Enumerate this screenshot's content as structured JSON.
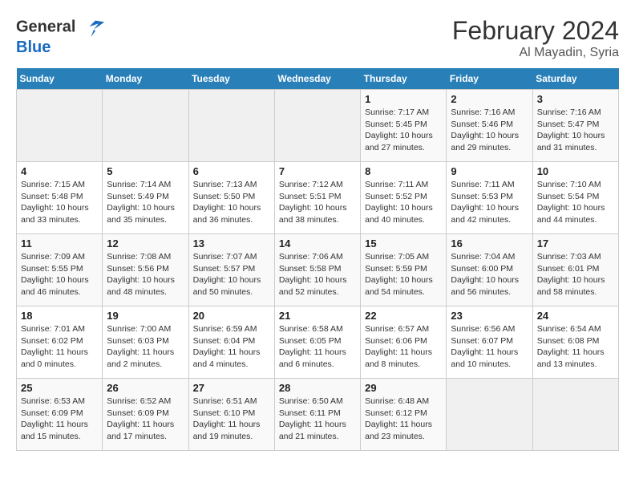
{
  "app": {
    "name": "GeneralBlue",
    "logo_color": "#1a6abf"
  },
  "header": {
    "title": "February 2024",
    "location": "Al Mayadin, Syria"
  },
  "weekdays": [
    "Sunday",
    "Monday",
    "Tuesday",
    "Wednesday",
    "Thursday",
    "Friday",
    "Saturday"
  ],
  "weeks": [
    [
      {
        "day": "",
        "info": ""
      },
      {
        "day": "",
        "info": ""
      },
      {
        "day": "",
        "info": ""
      },
      {
        "day": "",
        "info": ""
      },
      {
        "day": "1",
        "info": "Sunrise: 7:17 AM\nSunset: 5:45 PM\nDaylight: 10 hours and 27 minutes."
      },
      {
        "day": "2",
        "info": "Sunrise: 7:16 AM\nSunset: 5:46 PM\nDaylight: 10 hours and 29 minutes."
      },
      {
        "day": "3",
        "info": "Sunrise: 7:16 AM\nSunset: 5:47 PM\nDaylight: 10 hours and 31 minutes."
      }
    ],
    [
      {
        "day": "4",
        "info": "Sunrise: 7:15 AM\nSunset: 5:48 PM\nDaylight: 10 hours and 33 minutes."
      },
      {
        "day": "5",
        "info": "Sunrise: 7:14 AM\nSunset: 5:49 PM\nDaylight: 10 hours and 35 minutes."
      },
      {
        "day": "6",
        "info": "Sunrise: 7:13 AM\nSunset: 5:50 PM\nDaylight: 10 hours and 36 minutes."
      },
      {
        "day": "7",
        "info": "Sunrise: 7:12 AM\nSunset: 5:51 PM\nDaylight: 10 hours and 38 minutes."
      },
      {
        "day": "8",
        "info": "Sunrise: 7:11 AM\nSunset: 5:52 PM\nDaylight: 10 hours and 40 minutes."
      },
      {
        "day": "9",
        "info": "Sunrise: 7:11 AM\nSunset: 5:53 PM\nDaylight: 10 hours and 42 minutes."
      },
      {
        "day": "10",
        "info": "Sunrise: 7:10 AM\nSunset: 5:54 PM\nDaylight: 10 hours and 44 minutes."
      }
    ],
    [
      {
        "day": "11",
        "info": "Sunrise: 7:09 AM\nSunset: 5:55 PM\nDaylight: 10 hours and 46 minutes."
      },
      {
        "day": "12",
        "info": "Sunrise: 7:08 AM\nSunset: 5:56 PM\nDaylight: 10 hours and 48 minutes."
      },
      {
        "day": "13",
        "info": "Sunrise: 7:07 AM\nSunset: 5:57 PM\nDaylight: 10 hours and 50 minutes."
      },
      {
        "day": "14",
        "info": "Sunrise: 7:06 AM\nSunset: 5:58 PM\nDaylight: 10 hours and 52 minutes."
      },
      {
        "day": "15",
        "info": "Sunrise: 7:05 AM\nSunset: 5:59 PM\nDaylight: 10 hours and 54 minutes."
      },
      {
        "day": "16",
        "info": "Sunrise: 7:04 AM\nSunset: 6:00 PM\nDaylight: 10 hours and 56 minutes."
      },
      {
        "day": "17",
        "info": "Sunrise: 7:03 AM\nSunset: 6:01 PM\nDaylight: 10 hours and 58 minutes."
      }
    ],
    [
      {
        "day": "18",
        "info": "Sunrise: 7:01 AM\nSunset: 6:02 PM\nDaylight: 11 hours and 0 minutes."
      },
      {
        "day": "19",
        "info": "Sunrise: 7:00 AM\nSunset: 6:03 PM\nDaylight: 11 hours and 2 minutes."
      },
      {
        "day": "20",
        "info": "Sunrise: 6:59 AM\nSunset: 6:04 PM\nDaylight: 11 hours and 4 minutes."
      },
      {
        "day": "21",
        "info": "Sunrise: 6:58 AM\nSunset: 6:05 PM\nDaylight: 11 hours and 6 minutes."
      },
      {
        "day": "22",
        "info": "Sunrise: 6:57 AM\nSunset: 6:06 PM\nDaylight: 11 hours and 8 minutes."
      },
      {
        "day": "23",
        "info": "Sunrise: 6:56 AM\nSunset: 6:07 PM\nDaylight: 11 hours and 10 minutes."
      },
      {
        "day": "24",
        "info": "Sunrise: 6:54 AM\nSunset: 6:08 PM\nDaylight: 11 hours and 13 minutes."
      }
    ],
    [
      {
        "day": "25",
        "info": "Sunrise: 6:53 AM\nSunset: 6:09 PM\nDaylight: 11 hours and 15 minutes."
      },
      {
        "day": "26",
        "info": "Sunrise: 6:52 AM\nSunset: 6:09 PM\nDaylight: 11 hours and 17 minutes."
      },
      {
        "day": "27",
        "info": "Sunrise: 6:51 AM\nSunset: 6:10 PM\nDaylight: 11 hours and 19 minutes."
      },
      {
        "day": "28",
        "info": "Sunrise: 6:50 AM\nSunset: 6:11 PM\nDaylight: 11 hours and 21 minutes."
      },
      {
        "day": "29",
        "info": "Sunrise: 6:48 AM\nSunset: 6:12 PM\nDaylight: 11 hours and 23 minutes."
      },
      {
        "day": "",
        "info": ""
      },
      {
        "day": "",
        "info": ""
      }
    ]
  ]
}
